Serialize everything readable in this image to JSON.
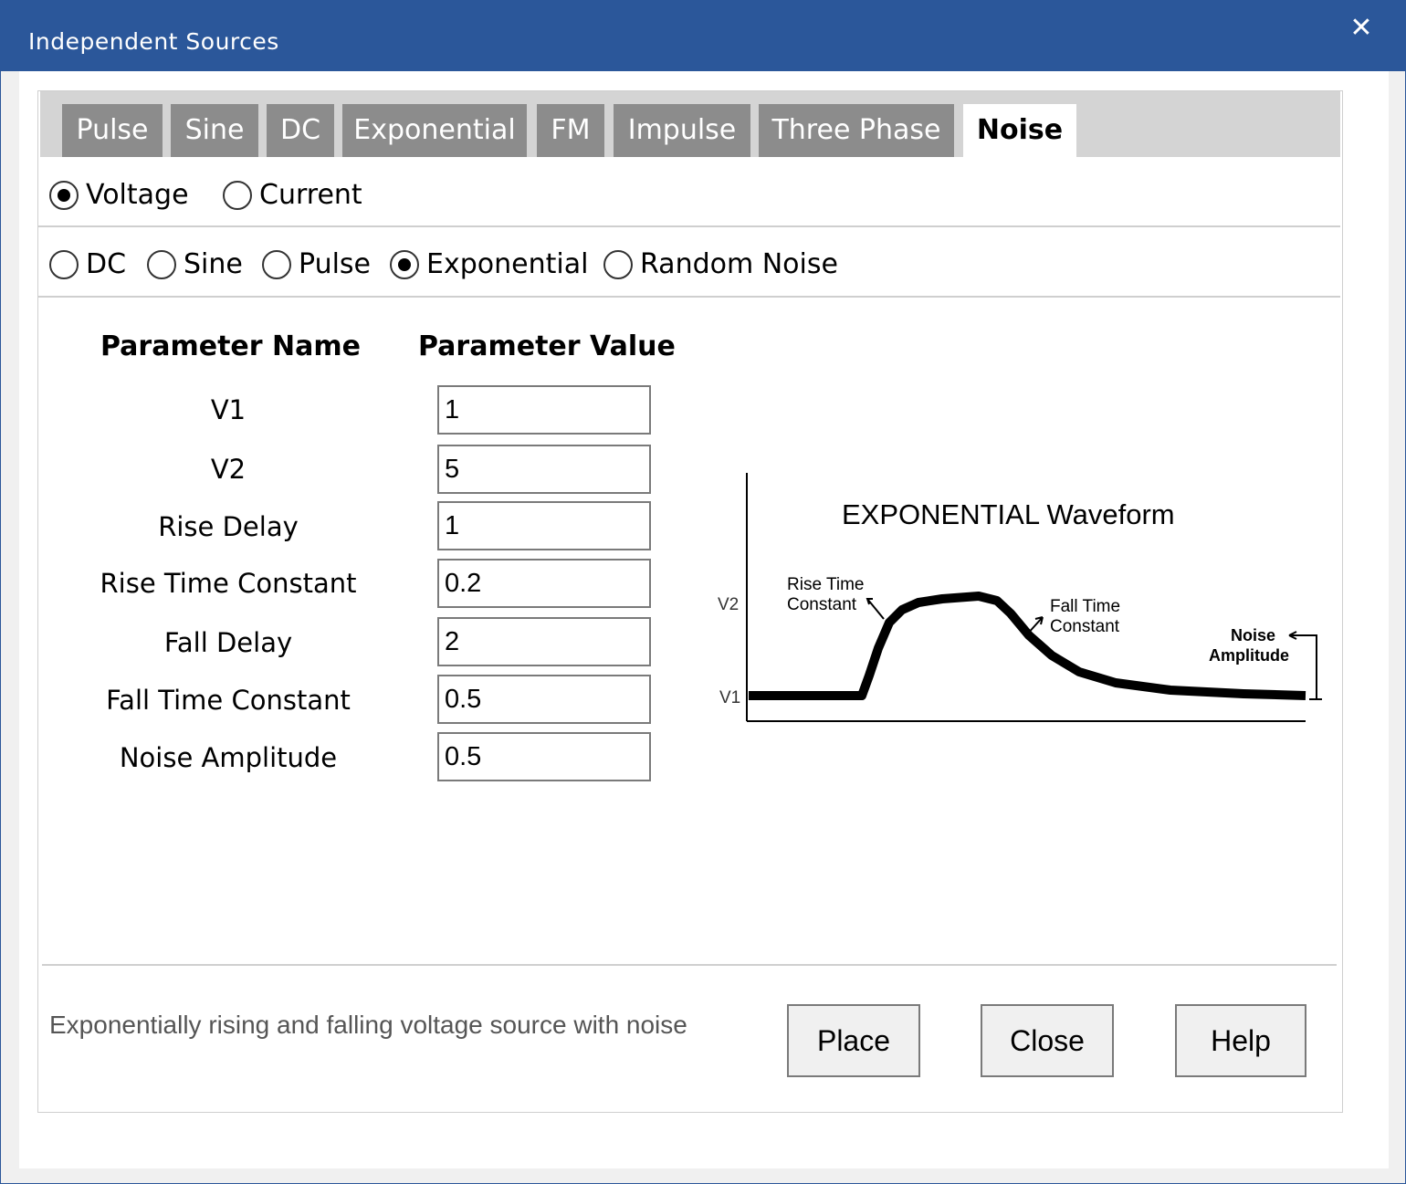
{
  "window": {
    "title": "Independent Sources",
    "close_glyph": "✕"
  },
  "tabs": [
    {
      "label": "Pulse"
    },
    {
      "label": "Sine"
    },
    {
      "label": "DC"
    },
    {
      "label": "Exponential"
    },
    {
      "label": "FM"
    },
    {
      "label": "Impulse"
    },
    {
      "label": "Three Phase"
    },
    {
      "label": "Noise",
      "active": true
    }
  ],
  "source_kind": {
    "options": [
      "Voltage",
      "Current"
    ],
    "selected": "Voltage"
  },
  "noise_base": {
    "options": [
      "DC",
      "Sine",
      "Pulse",
      "Exponential",
      "Random Noise"
    ],
    "selected": "Exponential"
  },
  "params": {
    "header_name": "Parameter Name",
    "header_value": "Parameter Value",
    "rows": [
      {
        "name": "V1",
        "value": "1"
      },
      {
        "name": "V2",
        "value": "5"
      },
      {
        "name": "Rise Delay",
        "value": "1"
      },
      {
        "name": "Rise Time Constant",
        "value": "0.2"
      },
      {
        "name": "Fall Delay",
        "value": "2"
      },
      {
        "name": "Fall Time Constant",
        "value": "0.5"
      },
      {
        "name": "Noise Amplitude",
        "value": "0.5"
      }
    ]
  },
  "diagram": {
    "title": "EXPONENTIAL Waveform",
    "v2": "V2",
    "v1": "V1",
    "rise_1": "Rise Time",
    "rise_2": "Constant",
    "fall_1": "Fall Time",
    "fall_2": "Constant",
    "noise_1": "Noise",
    "noise_2": "Amplitude"
  },
  "status_text": "Exponentially rising and falling voltage source with noise",
  "buttons": {
    "place": "Place",
    "close": "Close",
    "help": "Help"
  },
  "colors": {
    "titlebar": "#2b579a",
    "tab_inactive": "#8c8c8c",
    "tab_strip": "#d4d4d4"
  }
}
